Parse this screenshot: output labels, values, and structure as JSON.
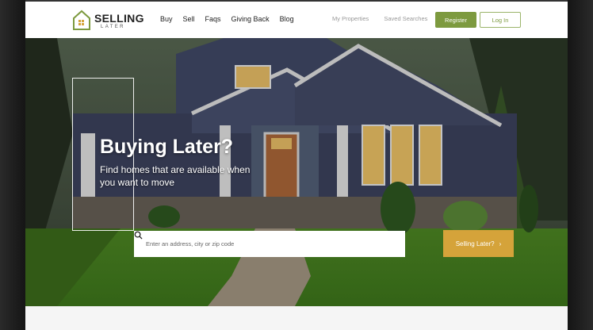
{
  "logo": {
    "word1": "SELLING",
    "word2": "LATER"
  },
  "nav": {
    "items": [
      "Buy",
      "Sell",
      "Faqs",
      "Giving Back",
      "Blog"
    ]
  },
  "nav_right": {
    "my_properties": "My Properties",
    "saved_searches": "Saved Searches"
  },
  "auth": {
    "register": "Register",
    "login": "Log In"
  },
  "hero": {
    "title": "Buying Later?",
    "subtitle": "Find homes that are available when you want to move"
  },
  "search": {
    "placeholder": "Enter an address, city or zip code",
    "icon": "search-icon"
  },
  "cta": {
    "label": "Selling Later?",
    "chevron": "›"
  },
  "colors": {
    "brand_green": "#7d9a3f",
    "cta_gold": "#d5a33a"
  }
}
